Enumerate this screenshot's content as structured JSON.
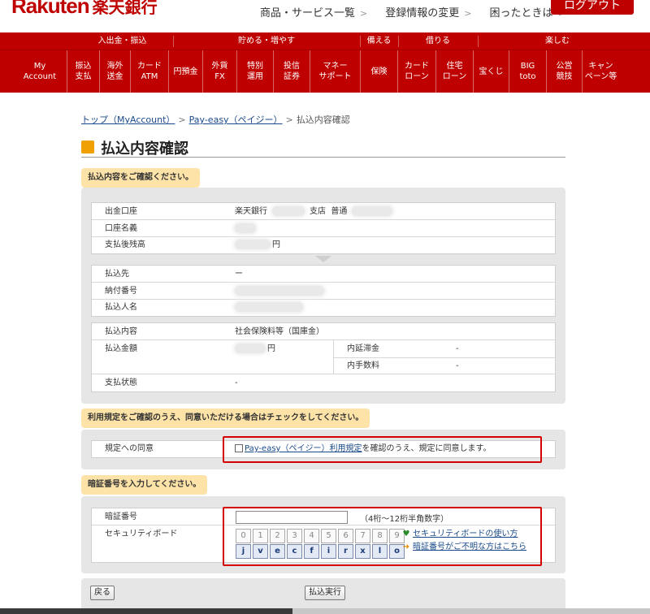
{
  "header": {
    "logo_en": "Rakuten",
    "logo_ja": "楽天銀行",
    "links": [
      "商品・サービス一覧",
      "登録情報の変更",
      "困ったときは"
    ],
    "logout": "ログアウト"
  },
  "nav": {
    "categories": [
      "入出金・振込",
      "貯める・増やす",
      "備える",
      "借りる",
      "楽しむ"
    ],
    "items": [
      "My\nAccount",
      "振込\n支払",
      "海外\n送金",
      "カード\nATM",
      "円預金",
      "外貨\nFX",
      "特別\n運用",
      "投信\n証券",
      "マネー\nサポート",
      "保険",
      "カード\nローン",
      "住宅\nローン",
      "宝くじ",
      "BIG\ntoto",
      "公営\n競技",
      "キャン\nペーン等"
    ]
  },
  "breadcrumb": {
    "home": "トップ（MyAccount）",
    "payeasy": "Pay-easy（ペイジー）",
    "current": "払込内容確認",
    "sep": ">"
  },
  "page": {
    "title": "払込内容確認"
  },
  "section1": {
    "label": "払込内容をご確認ください。",
    "account": {
      "withdraw_label": "出金口座",
      "bank": "楽天銀行",
      "branch": "支店",
      "type": "普通",
      "name_label": "口座名義",
      "balance_label": "支払後残高",
      "yen": "円"
    },
    "payee": {
      "payee_label": "払込先",
      "payee_value": "ー",
      "number_label": "納付番号",
      "payer_label": "払込人名"
    },
    "detail": {
      "content_label": "払込内容",
      "content_value": "社会保険料等（国庫金）",
      "amount_label": "払込金額",
      "yen": "円",
      "late_label": "内延滞金",
      "late_value": "-",
      "fee_label": "内手数料",
      "fee_value": "-",
      "status_label": "支払状態",
      "status_value": "-"
    }
  },
  "section2": {
    "label": "利用規定をご確認のうえ、同意いただける場合はチェックをしてください。",
    "agree_label": "規定への同意",
    "agree_link": "Pay-easy（ペイジー）利用規定",
    "agree_text": "を確認のうえ、規定に同意します。"
  },
  "section3": {
    "label": "暗証番号を入力してください。",
    "pin_label": "暗証番号",
    "pin_hint": "（4桁〜12桁半角数字）",
    "board_label": "セキュリティボード",
    "numbers": [
      "0",
      "1",
      "2",
      "3",
      "4",
      "5",
      "6",
      "7",
      "8",
      "9"
    ],
    "letters": [
      "j",
      "v",
      "e",
      "c",
      "f",
      "i",
      "r",
      "x",
      "l",
      "o"
    ],
    "link_usage": "セキュリティボードの使い方",
    "link_forgot": "暗証番号がご不明な方はこちら"
  },
  "buttons": {
    "back": "戻る",
    "execute": "払込実行"
  },
  "colors": {
    "brand_red": "#bf0000",
    "label_bg": "#fde3a8",
    "highlight_red": "#d40000"
  }
}
